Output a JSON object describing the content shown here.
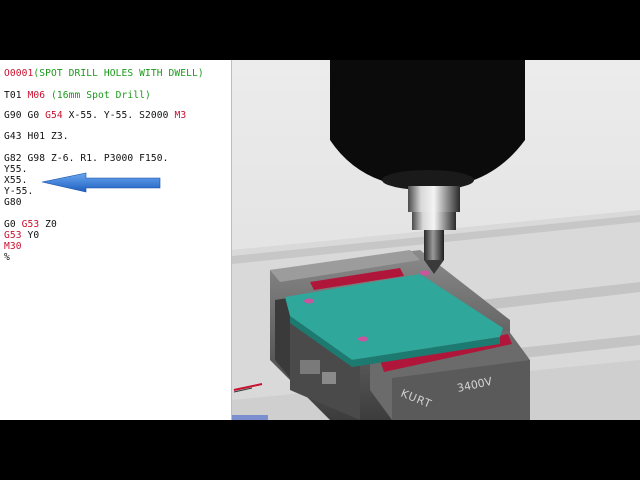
{
  "program": {
    "lines": [
      {
        "id": "l1",
        "tokens": [
          {
            "t": "O0001",
            "c": "red"
          },
          {
            "t": "(SPOT DRILL HOLES WITH DWELL)",
            "c": "grn"
          }
        ]
      },
      {
        "id": "l2",
        "tokens": [
          {
            "t": "T01 ",
            "c": "blk"
          },
          {
            "t": "M06",
            "c": "red"
          },
          {
            "t": " (16mm Spot Drill)",
            "c": "grn"
          }
        ]
      },
      {
        "id": "l3",
        "tokens": [
          {
            "t": "G90 G0 ",
            "c": "blk"
          },
          {
            "t": "G54",
            "c": "red"
          },
          {
            "t": " X-55. Y-55. S2000 ",
            "c": "blk"
          },
          {
            "t": "M3",
            "c": "red"
          }
        ]
      },
      {
        "id": "l4",
        "tokens": [
          {
            "t": "G43 H01 Z3.",
            "c": "blk"
          }
        ]
      },
      {
        "id": "l5",
        "tokens": [
          {
            "t": "G82 G98 Z-6. R1. P3000 F150.",
            "c": "blk"
          }
        ]
      },
      {
        "id": "l6",
        "tokens": [
          {
            "t": "Y55.",
            "c": "blk"
          }
        ]
      },
      {
        "id": "l7",
        "tokens": [
          {
            "t": "X55.",
            "c": "blk"
          }
        ]
      },
      {
        "id": "l8",
        "tokens": [
          {
            "t": "Y-55.",
            "c": "blk"
          }
        ]
      },
      {
        "id": "l9",
        "tokens": [
          {
            "t": "G80",
            "c": "blk"
          }
        ]
      },
      {
        "id": "l10",
        "tokens": [
          {
            "t": "G0 ",
            "c": "blk"
          },
          {
            "t": "G53",
            "c": "red"
          },
          {
            "t": " Z0",
            "c": "blk"
          }
        ]
      },
      {
        "id": "l11",
        "tokens": [
          {
            "t": "G53",
            "c": "red"
          },
          {
            "t": " Y0",
            "c": "blk"
          }
        ]
      },
      {
        "id": "l12",
        "tokens": [
          {
            "t": "M30",
            "c": "red"
          }
        ]
      },
      {
        "id": "l13",
        "tokens": [
          {
            "t": "%",
            "c": "blk"
          }
        ]
      }
    ]
  },
  "scene": {
    "vise_brand": "KURT",
    "vise_model": "3400V"
  },
  "colors": {
    "part": "#2fa79b",
    "jaw_stripe": "#b0163a",
    "arrow": "#2f7bd8",
    "spindle": "#0b0b0b"
  }
}
